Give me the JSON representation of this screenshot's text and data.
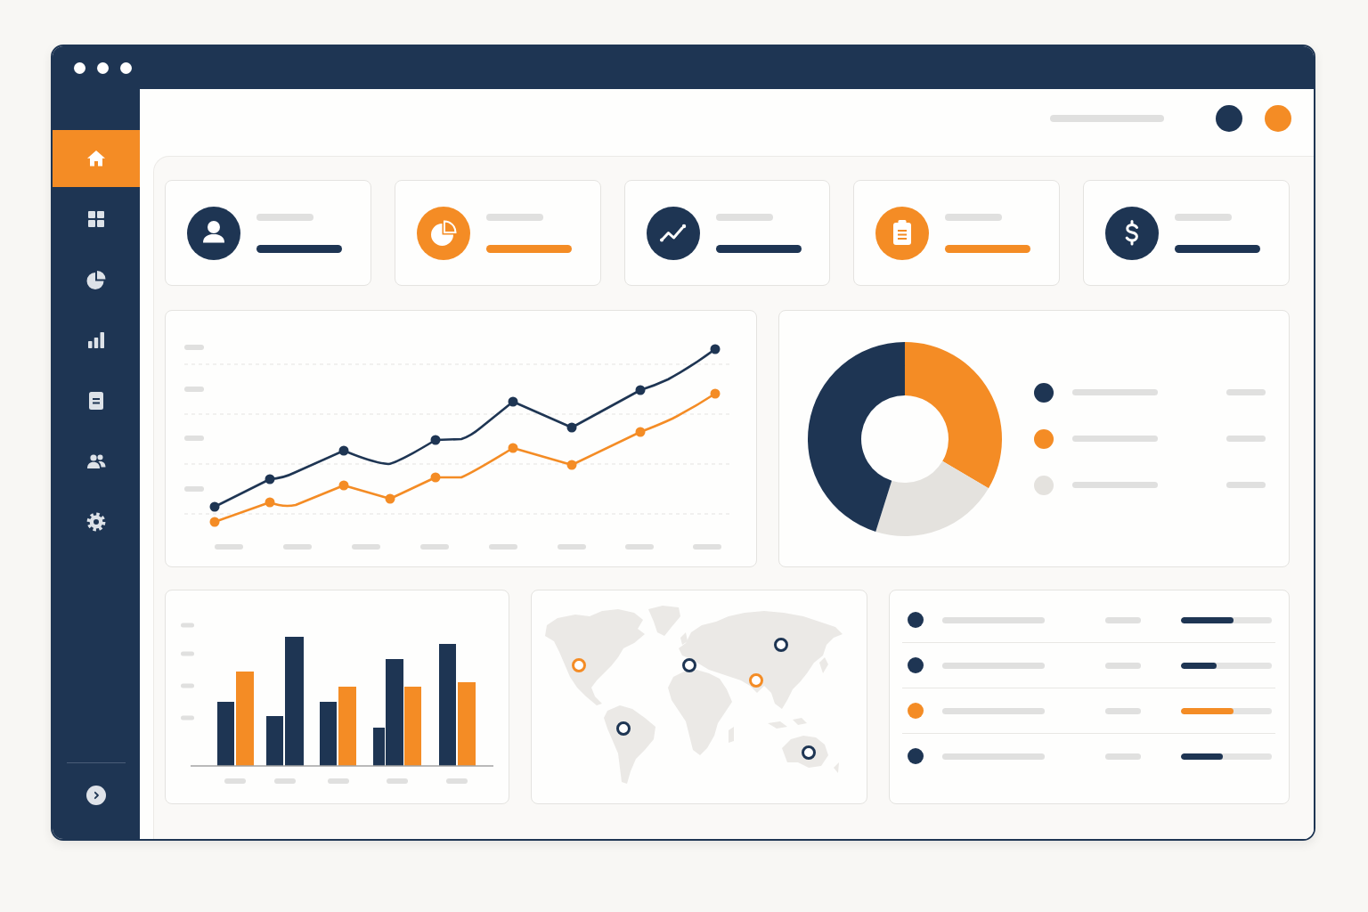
{
  "sidebar": {
    "items": [
      {
        "kind": "home",
        "selected": true
      },
      {
        "kind": "grid",
        "selected": false
      },
      {
        "kind": "pie",
        "selected": false
      },
      {
        "kind": "bars",
        "selected": false
      },
      {
        "kind": "document",
        "selected": false
      },
      {
        "kind": "users",
        "selected": false
      },
      {
        "kind": "settings",
        "selected": false
      }
    ]
  },
  "header": {
    "avatars": [
      {
        "color": "#1e3553"
      },
      {
        "color": "#f48c25"
      }
    ]
  },
  "stat_cards": [
    {
      "kind": "user",
      "color": "#1e3553"
    },
    {
      "kind": "pie",
      "color": "#f48c25"
    },
    {
      "kind": "trend",
      "color": "#1e3553"
    },
    {
      "kind": "clipboard",
      "color": "#f48c25"
    },
    {
      "kind": "dollar",
      "color": "#1e3553"
    }
  ],
  "donut_legend": [
    {
      "color": "#1e3553"
    },
    {
      "color": "#f48c25"
    },
    {
      "color": "#e4e2de"
    }
  ],
  "map": {
    "markers": [
      {
        "color": "#1e3553"
      },
      {
        "color": "#f48c25"
      },
      {
        "color": "#1e3553"
      },
      {
        "color": "#f48c25"
      },
      {
        "color": "#1e3553"
      },
      {
        "color": "#1e3553"
      }
    ]
  },
  "list": {
    "rows": [
      {
        "color": "#1e3553",
        "level": 0.58
      },
      {
        "color": "#1e3553",
        "level": 0.39
      },
      {
        "color": "#f48c25",
        "level": 0.58
      },
      {
        "color": "#1e3553",
        "level": 0.46
      }
    ]
  }
}
